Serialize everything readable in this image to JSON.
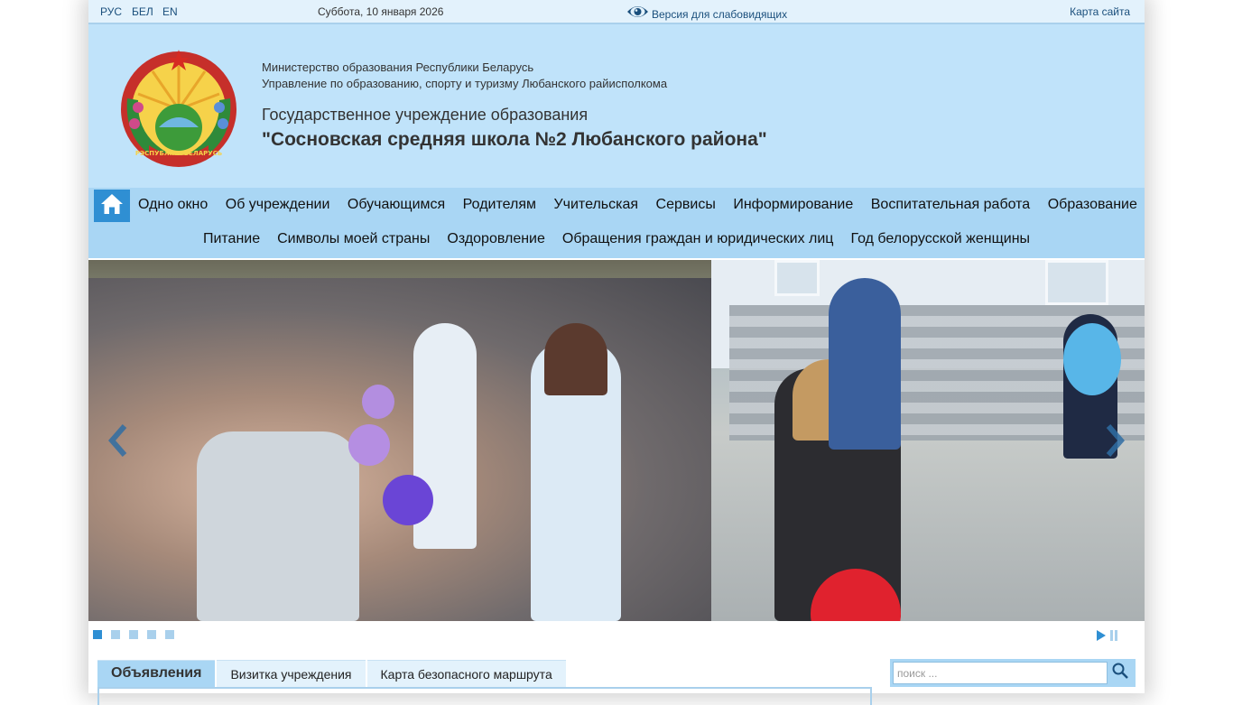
{
  "topbar": {
    "lang_ru": "РУС",
    "lang_by": "БЕЛ",
    "lang_en": "EN",
    "date": "Суббота, 10 января 2026",
    "vision_label": "Версия для слабовидящих",
    "sitemap_label": "Карта сайта"
  },
  "header": {
    "ministry": "Министерство образования Республики Беларусь",
    "department": "Управление по образованию, спорту и туризму Любанского райисполкома",
    "org_type": "Государственное учреждение образования",
    "org_name": "\"Сосновская средняя школа №2 Любанского района\"",
    "emblem_text": "РЭСПУБЛІКА БЕЛАРУСЬ"
  },
  "nav": {
    "home_icon": "home-icon",
    "row1": [
      "Одно окно",
      "Об учреждении",
      "Обучающимся",
      "Родителям",
      "Учительская",
      "Сервисы",
      "Информирование",
      "Воспитательная работа",
      "Образование"
    ],
    "row2": [
      "Питание",
      "Символы моей страны",
      "Оздоровление",
      "Обращения граждан и юридических лиц",
      "Год белорусской женщины"
    ]
  },
  "slider": {
    "slide_count": 5,
    "active_index": 0
  },
  "tabs": [
    "Объявления",
    "Визитка учреждения",
    "Карта безопасного маршрута"
  ],
  "search": {
    "placeholder": "поиск ..."
  },
  "colors": {
    "topbar_bg": "#e3f2fc",
    "header_bg": "#c0e3fa",
    "nav_bg": "#a9d6f4",
    "accent": "#2f8fd3",
    "link": "#1a4f7c"
  }
}
